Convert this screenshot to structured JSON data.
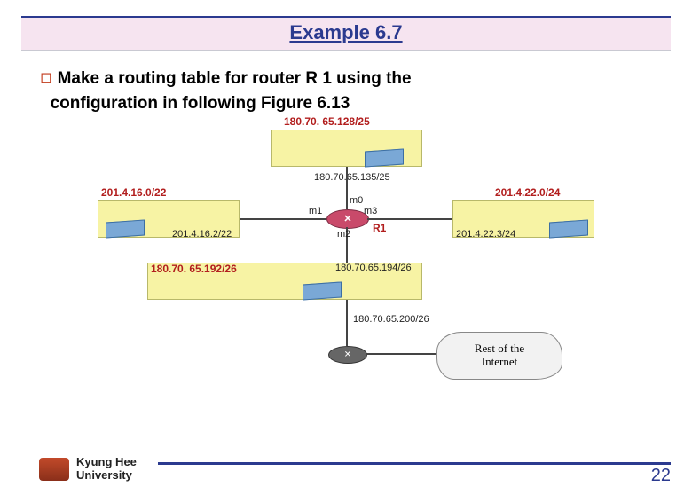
{
  "title": "Example 6.7",
  "body_line1": "Make a routing table for router R 1 using the",
  "body_line2": "configuration in following Figure 6.13",
  "diagram": {
    "net_top": {
      "label": "180.70. 65.128/25",
      "host_ip": "180.70.65.135/25"
    },
    "net_left": {
      "label": "201.4.16.0/22",
      "host_ip": "201.4.16.2/22"
    },
    "net_right": {
      "label": "201.4.22.0/24",
      "host_ip": "201.4.22.3/24"
    },
    "net_bottom": {
      "label": "180.70. 65.192/26",
      "host_ip": "180.70.65.194/26"
    },
    "router_name": "R1",
    "ifaces": {
      "m0": "m0",
      "m1": "m1",
      "m2": "m2",
      "m3": "m3"
    },
    "below_link_ip": "180.70.65.200/26",
    "cloud": "Rest of the\nInternet"
  },
  "footer": {
    "university_l1": "Kyung Hee",
    "university_l2": "University",
    "page": "22"
  }
}
